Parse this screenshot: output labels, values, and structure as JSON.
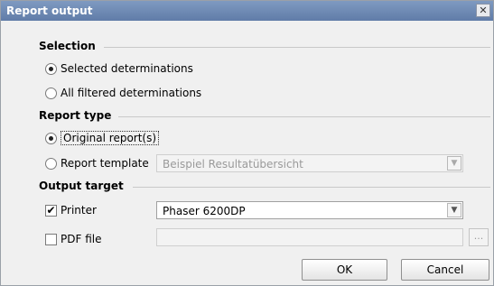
{
  "window": {
    "title": "Report output",
    "close_glyph": "✕"
  },
  "selection": {
    "heading": "Selection",
    "options": [
      {
        "label": "Selected determinations",
        "checked": true
      },
      {
        "label": "All filtered determinations",
        "checked": false
      }
    ]
  },
  "report_type": {
    "heading": "Report type",
    "original_label": "Original report(s)",
    "original_checked": true,
    "template_label": "Report template",
    "template_checked": false,
    "template_value": "Beispiel Resultatübersicht"
  },
  "output_target": {
    "heading": "Output target",
    "printer_label": "Printer",
    "printer_checked": true,
    "printer_value": "Phaser 6200DP",
    "pdf_label": "PDF file",
    "pdf_checked": false,
    "pdf_value": "",
    "browse_label": "..."
  },
  "buttons": {
    "ok": "OK",
    "cancel": "Cancel"
  }
}
